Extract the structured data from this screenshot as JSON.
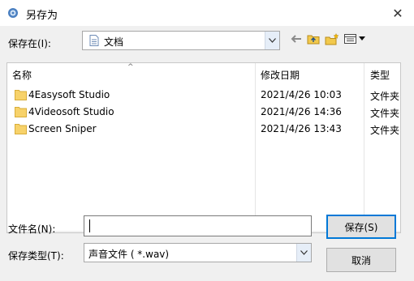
{
  "window": {
    "title": "另存为",
    "close_glyph": "✕"
  },
  "save_in": {
    "label": "保存在(I):",
    "value": "文档",
    "icon": "document-icon"
  },
  "toolbar": {
    "back_glyph": "🡐",
    "icons": [
      "back-arrow-icon",
      "up-folder-icon",
      "new-folder-icon",
      "view-menu-icon"
    ]
  },
  "file_list": {
    "columns": [
      "名称",
      "修改日期",
      "类型"
    ],
    "sort_glyph": "^",
    "rows": [
      {
        "name": "4Easysoft Studio",
        "date": "2021/4/26 10:03",
        "type": "文件夹"
      },
      {
        "name": "4Videosoft Studio",
        "date": "2021/4/26 14:36",
        "type": "文件夹"
      },
      {
        "name": "Screen Sniper",
        "date": "2021/4/26 13:43",
        "type": "文件夹"
      }
    ],
    "scroll_left_glyph": "◀",
    "scroll_right_glyph": "▶"
  },
  "filename": {
    "label": "文件名(N):",
    "value": ""
  },
  "filetype": {
    "label": "保存类型(T):",
    "value": "声音文件 ( *.wav)"
  },
  "buttons": {
    "save": "保存(S)",
    "cancel": "取消"
  },
  "colors": {
    "folder": "#f7d26a",
    "accent": "#0078d7",
    "dialog_bg": "#f0f0f0"
  }
}
